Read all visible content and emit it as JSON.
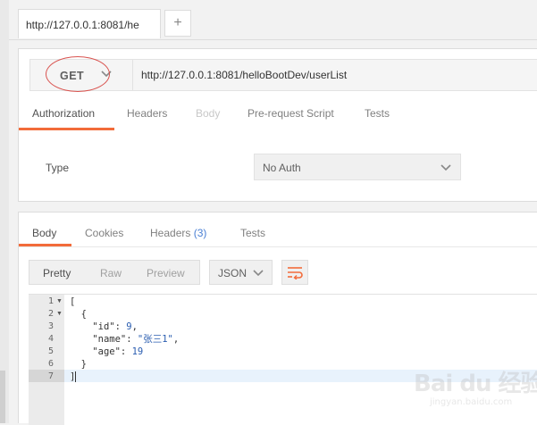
{
  "tabbar": {
    "tab_title": "http://127.0.0.1:8081/he",
    "add_label": "+"
  },
  "request": {
    "method": "GET",
    "url": "http://127.0.0.1:8081/helloBootDev/userList",
    "tabs": [
      {
        "label": "Authorization"
      },
      {
        "label": "Headers"
      },
      {
        "label": "Body"
      },
      {
        "label": "Pre-request Script"
      },
      {
        "label": "Tests"
      }
    ],
    "auth": {
      "type_label": "Type",
      "type_value": "No Auth"
    }
  },
  "response": {
    "tabs": [
      {
        "label": "Body"
      },
      {
        "label": "Cookies"
      },
      {
        "label": "Headers",
        "count": "(3)"
      },
      {
        "label": "Tests"
      }
    ],
    "views": [
      {
        "label": "Pretty"
      },
      {
        "label": "Raw"
      },
      {
        "label": "Preview"
      }
    ],
    "format": "JSON",
    "line_numbers": [
      "1",
      "2",
      "3",
      "4",
      "5",
      "6",
      "7"
    ],
    "code": {
      "l1": "[",
      "l2": "{",
      "l3_key": "\"id\"",
      "l3_val": "9",
      "l4_key": "\"name\"",
      "l4_val": "\"张三1\"",
      "l5_key": "\"age\"",
      "l5_val": "19",
      "l6": "}",
      "l7": "]"
    }
  },
  "watermark": {
    "brand": "Bai du 经验",
    "site": "jingyan.baidu.com"
  },
  "colors": {
    "accent": "#f26b3a",
    "highlight_ring": "#d9534f",
    "json_value": "#2a5db0",
    "count": "#4a7fd4"
  }
}
